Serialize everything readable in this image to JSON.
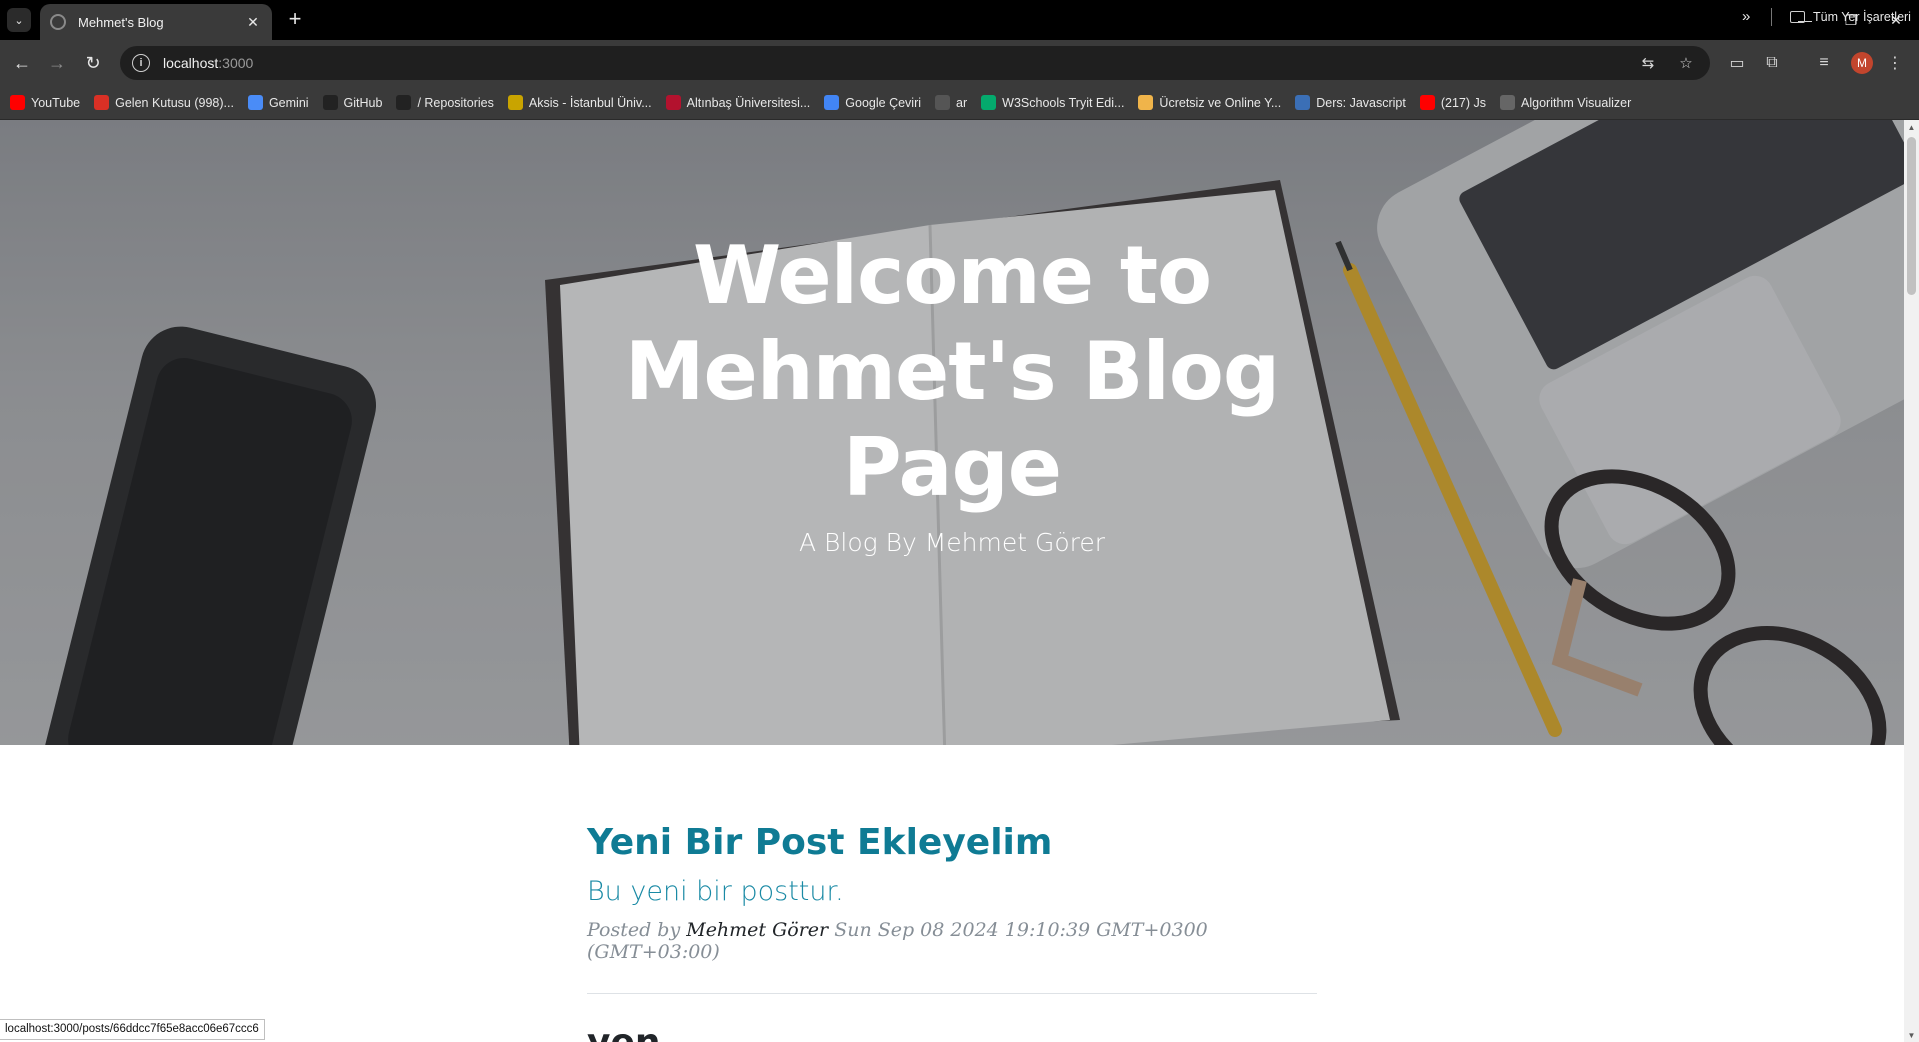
{
  "browser": {
    "tab_search_glyph": "⌄",
    "tab": {
      "title": "Mehmet's Blog",
      "close_glyph": "✕"
    },
    "new_tab_glyph": "+",
    "window": {
      "minimize": "—",
      "restore": "❐",
      "close": "✕"
    },
    "nav": {
      "back": "←",
      "forward": "→",
      "reload": "↻"
    },
    "address": {
      "host": "localhost",
      "port": ":3000"
    },
    "omnibox_icons": [
      "translate-icon",
      "bookmark-star-icon"
    ],
    "profile_initial": "M"
  },
  "bookmarks": {
    "items": [
      {
        "label": "YouTube",
        "icon": "youtube-icon",
        "color": "#ff0000"
      },
      {
        "label": "Gelen Kutusu (998)...",
        "icon": "gmail-icon",
        "color": "#d93025"
      },
      {
        "label": "Gemini",
        "icon": "gemini-icon",
        "color": "#4a8cf7"
      },
      {
        "label": "GitHub",
        "icon": "github-icon",
        "color": "#222222"
      },
      {
        "label": "/ Repositories",
        "icon": "github-icon",
        "color": "#222222"
      },
      {
        "label": "Aksis - İstanbul Üniv...",
        "icon": "aksis-icon",
        "color": "#c9a400"
      },
      {
        "label": "Altınbaş Üniversitesi...",
        "icon": "altinbas-icon",
        "color": "#b3122e"
      },
      {
        "label": "Google Çeviri",
        "icon": "google-translate-icon",
        "color": "#4285f4"
      },
      {
        "label": "ar",
        "icon": "globe-icon",
        "color": "#555555"
      },
      {
        "label": "W3Schools Tryit Edi...",
        "icon": "w3schools-icon",
        "color": "#04aa6d"
      },
      {
        "label": "Ücretsiz ve Online Y...",
        "icon": "coin-icon",
        "color": "#f0b44a"
      },
      {
        "label": "Ders: Javascript",
        "icon": "javascript-icon",
        "color": "#3b6fb6"
      },
      {
        "label": "(217) Js",
        "icon": "youtube-icon",
        "color": "#ff0000"
      },
      {
        "label": "Algorithm Visualizer",
        "icon": "algorithm-icon",
        "color": "#666666"
      }
    ],
    "more_glyph": "»",
    "all_bookmarks": "Tüm Yer İşaretleri"
  },
  "hero": {
    "title": "Welcome to Mehmet's Blog Page",
    "subtitle": "A Blog By Mehmet Görer"
  },
  "posts": [
    {
      "title": "Yeni Bir Post Ekleyelim",
      "subtitle": "Bu yeni bir posttur.",
      "meta_prefix": "Posted by",
      "author": "Mehmet Görer",
      "date": "Sun Sep 08 2024 19:10:39 GMT+0300 (GMT+03:00)"
    },
    {
      "title": "yen"
    }
  ],
  "status_bar": {
    "url": "localhost:3000/posts/66ddcc7f65e8acc06e67ccc6"
  }
}
